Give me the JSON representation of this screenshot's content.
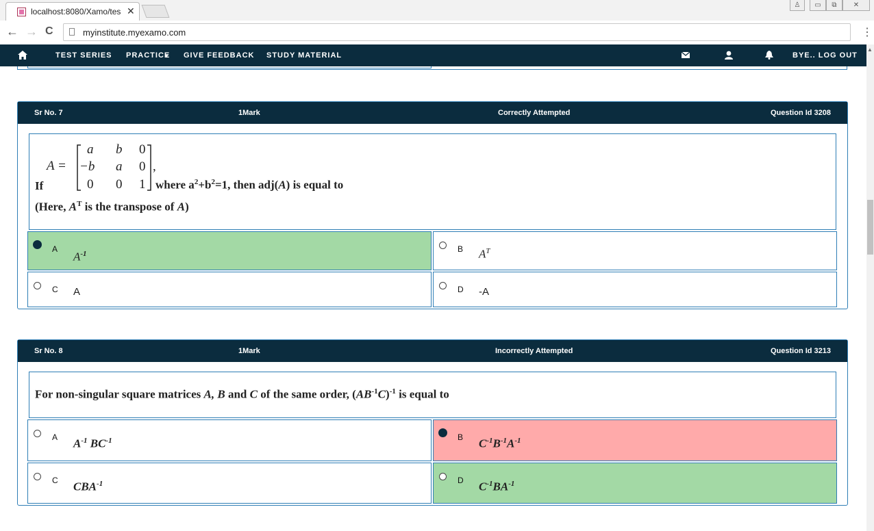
{
  "browser": {
    "tab_title": "localhost:8080/Xamo/tes",
    "tab_close": "✕",
    "url": "myinstitute.myexamo.com",
    "back": "←",
    "forward": "→",
    "reload": "C",
    "menu": "⋮",
    "win_user": "♙",
    "win_min": "▭",
    "win_max": "⧉",
    "win_close": "✕"
  },
  "navbar": {
    "home_icon": "home-icon",
    "items": [
      "TEST SERIES",
      "PRACTICE",
      "GIVE FEEDBACK",
      "STUDY MATERIAL"
    ],
    "practice_caret": "▾",
    "logout": "BYE.. LOG OUT",
    "mail_icon": "✉",
    "user_icon": "👤",
    "bell_icon": "🔔"
  },
  "questions": [
    {
      "sr": "Sr No. 7",
      "marks": "1Mark",
      "status": "Correctly Attempted",
      "qid": "Question Id 3208",
      "matrix_lhs": "A =",
      "matrix": [
        [
          "a",
          "b",
          "0"
        ],
        [
          "−b",
          "a",
          "0"
        ],
        [
          "0",
          "0",
          "1"
        ]
      ],
      "matrix_comma": ",",
      "line1_prefix": "If",
      "line1_text": "where a",
      "line1_sup1": "2",
      "line1_mid": "+b",
      "line1_sup2": "2",
      "line1_end": "=1, then adj(",
      "line1_var": "A",
      "line1_close": ") is equal to",
      "line2_start": "(Here, ",
      "line2_var": "A",
      "line2_sup": "T",
      "line2_mid": " is the transpose of ",
      "line2_var2": "A",
      "line2_end": ")",
      "options": [
        {
          "letter": "A",
          "base": "A",
          "sup": "-1",
          "selected": true,
          "state": "correct"
        },
        {
          "letter": "B",
          "base": "A",
          "sup": "T",
          "selected": false,
          "state": "none"
        },
        {
          "letter": "C",
          "text": "A",
          "selected": false,
          "state": "none"
        },
        {
          "letter": "D",
          "text": "-A",
          "selected": false,
          "state": "none"
        }
      ]
    },
    {
      "sr": "Sr No. 8",
      "marks": "1Mark",
      "status": "Incorrectly Attempted",
      "qid": "Question Id 3213",
      "text_start": "For non-singular square matrices ",
      "text_vars": "A, B",
      "text_and": " and ",
      "text_c": "C",
      "text_mid": " of the same order, (",
      "text_ab": "AB",
      "text_sup1": "-1",
      "text_c2": "C",
      "text_close": ")",
      "text_sup2": "-1",
      "text_end": " is equal to",
      "options": [
        {
          "letter": "A",
          "html": "A<sup>-1</sup> BC<sup>-1</sup>",
          "p1": "A",
          "s1": "-1",
          "p2": " BC",
          "s2": "-1",
          "selected": false,
          "state": "none"
        },
        {
          "letter": "B",
          "p1": "C",
          "s1": "-1",
          "p2": "B",
          "s2": "-1",
          "p3": "A",
          "s3": "-1",
          "selected": true,
          "state": "wrong"
        },
        {
          "letter": "C",
          "p1": "CBA",
          "s1": "-1",
          "selected": false,
          "state": "none"
        },
        {
          "letter": "D",
          "p1": "C",
          "s1": "-1",
          "p2": "BA",
          "s2": "-1",
          "selected": false,
          "state": "correct"
        }
      ]
    }
  ]
}
